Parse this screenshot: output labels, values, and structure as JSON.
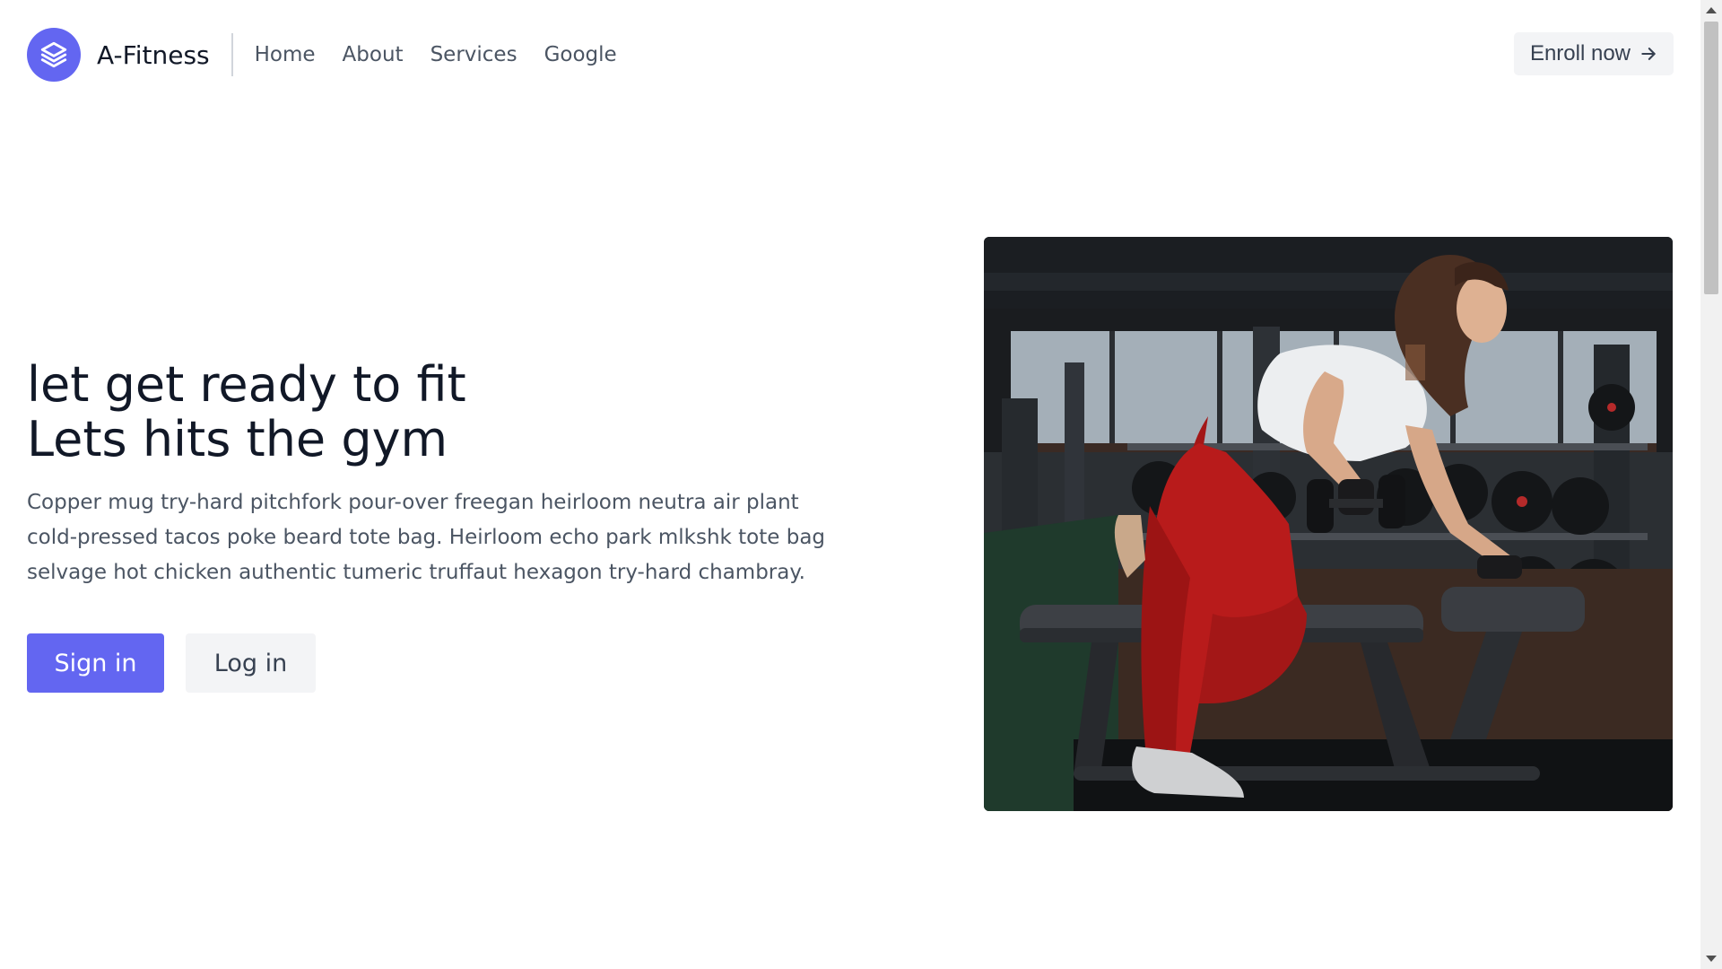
{
  "header": {
    "brand_name": "A-Fitness",
    "logo_icon": "layers-icon",
    "nav": [
      "Home",
      "About",
      "Services",
      "Google"
    ],
    "enroll_label": "Enroll now",
    "enroll_icon": "arrow-right-icon"
  },
  "hero": {
    "title_line1": "let get ready to fit",
    "title_line2": "Lets hits the gym",
    "description": "Copper mug try-hard pitchfork pour-over freegan heirloom neutra air plant cold-pressed tacos poke beard tote bag. Heirloom echo park mlkshk tote bag selvage hot chicken authentic tumeric truffaut hexagon try-hard chambray.",
    "primary_button": "Sign in",
    "secondary_button": "Log in",
    "image": "gym-photo"
  },
  "colors": {
    "accent": "#6366f1",
    "button_secondary_bg": "#f3f4f6",
    "heading": "#111827",
    "body_text": "#4b5563"
  }
}
